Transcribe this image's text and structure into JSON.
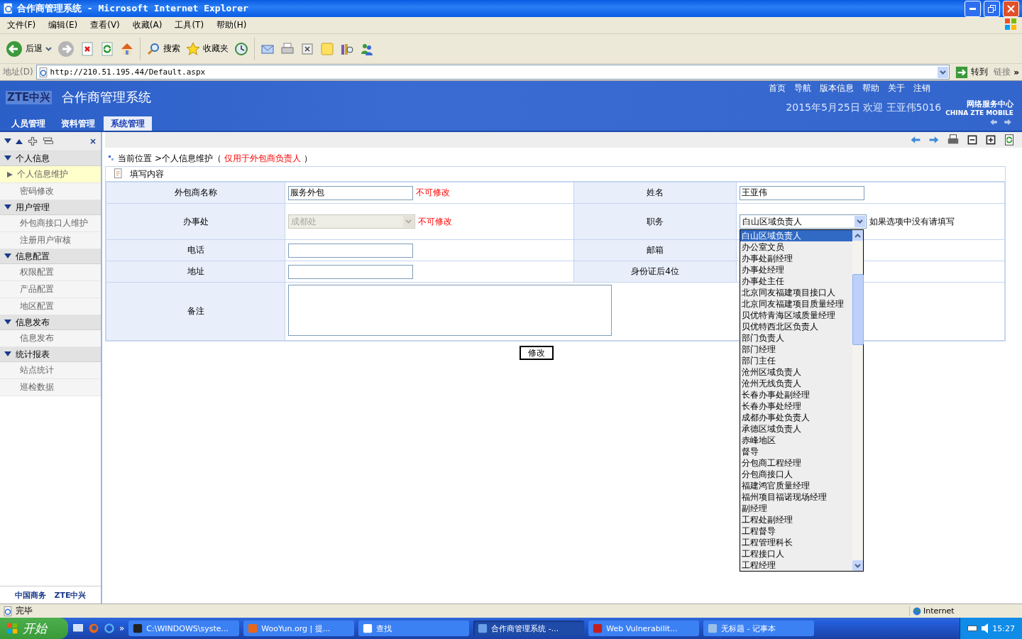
{
  "window": {
    "title": "合作商管理系统 - Microsoft Internet Explorer"
  },
  "menu": [
    "文件(F)",
    "编辑(E)",
    "查看(V)",
    "收藏(A)",
    "工具(T)",
    "帮助(H)"
  ],
  "toolbar": {
    "back": "后退",
    "search": "搜索",
    "favorites": "收藏夹"
  },
  "address": {
    "label": "地址(D)",
    "url": "http://210.51.195.44/Default.aspx",
    "go": "转到",
    "links": "链接",
    "more": "»"
  },
  "header": {
    "logo": "ZTE中兴",
    "title": "合作商管理系统",
    "nav": [
      "首页",
      "导航",
      "版本信息",
      "帮助",
      "关于",
      "注销"
    ],
    "welcome": "2015年5月25日 欢迎 王亚伟5016",
    "brand": "网络服务中心",
    "brand_sub": "CHINA ZTE MOBILE",
    "tabs": [
      {
        "label": "人员管理",
        "selected": false
      },
      {
        "label": "资料管理",
        "selected": false
      },
      {
        "label": "系统管理",
        "selected": true
      }
    ]
  },
  "sidebar": {
    "close": "×",
    "groups": [
      {
        "title": "个人信息",
        "expanded": true,
        "items": [
          {
            "label": "个人信息维护",
            "selected": true
          },
          {
            "label": "密码修改",
            "selected": false
          }
        ]
      },
      {
        "title": "用户管理",
        "expanded": true,
        "items": [
          {
            "label": "外包商接口人维护",
            "selected": false
          },
          {
            "label": "注册用户审核",
            "selected": false
          }
        ]
      },
      {
        "title": "信息配置",
        "expanded": true,
        "items": [
          {
            "label": "权限配置",
            "selected": false
          },
          {
            "label": "产品配置",
            "selected": false
          },
          {
            "label": "地区配置",
            "selected": false
          }
        ]
      },
      {
        "title": "信息发布",
        "expanded": true,
        "items": [
          {
            "label": "信息发布",
            "selected": false
          }
        ]
      },
      {
        "title": "统计报表",
        "expanded": true,
        "items": [
          {
            "label": "站点统计",
            "selected": false
          },
          {
            "label": "巡检数据",
            "selected": false
          }
        ]
      }
    ],
    "footer": [
      "中国商务",
      "ZTE中兴"
    ]
  },
  "breadcrumb": {
    "label": "当前位置",
    "path": ">个人信息维护（",
    "note": "仅用于外包商负责人",
    "tail": "）"
  },
  "section": "填写内容",
  "form": {
    "rows": [
      {
        "cells": [
          {
            "label": "外包商名称",
            "kind": "text",
            "value": "服务外包",
            "note": "不可修改"
          },
          {
            "label": "姓名",
            "kind": "text",
            "value": "王亚伟"
          }
        ]
      },
      {
        "cells": [
          {
            "label": "办事处",
            "kind": "select",
            "value": "成都处",
            "disabled": true,
            "note": "不可修改"
          },
          {
            "label": "职务",
            "kind": "select",
            "value": "白山区域负责人",
            "disabled": false,
            "hint": "如果选项中没有请填写"
          }
        ]
      },
      {
        "cells": [
          {
            "label": "电话",
            "kind": "text"
          },
          {
            "label": "邮箱",
            "kind": "covered"
          }
        ]
      },
      {
        "cells": [
          {
            "label": "地址",
            "kind": "text"
          },
          {
            "label": "身份证后4位",
            "kind": "covered"
          }
        ]
      }
    ],
    "remark": {
      "label": "备注"
    },
    "submit": "修改"
  },
  "dropdown": {
    "options": [
      {
        "label": "白山区域负责人",
        "selected": true
      },
      {
        "label": "办公室文员",
        "selected": false
      },
      {
        "label": "办事处副经理",
        "selected": false
      },
      {
        "label": "办事处经理",
        "selected": false
      },
      {
        "label": "办事处主任",
        "selected": false
      },
      {
        "label": "北京同友福建项目接口人",
        "selected": false
      },
      {
        "label": "北京同友福建项目质量经理",
        "selected": false
      },
      {
        "label": "贝优特青海区域质量经理",
        "selected": false
      },
      {
        "label": "贝优特西北区负责人",
        "selected": false
      },
      {
        "label": "部门负责人",
        "selected": false
      },
      {
        "label": "部门经理",
        "selected": false
      },
      {
        "label": "部门主任",
        "selected": false
      },
      {
        "label": "沧州区域负责人",
        "selected": false
      },
      {
        "label": "沧州无线负责人",
        "selected": false
      },
      {
        "label": "长春办事处副经理",
        "selected": false
      },
      {
        "label": "长春办事处经理",
        "selected": false
      },
      {
        "label": "成都办事处负责人",
        "selected": false
      },
      {
        "label": "承德区域负责人",
        "selected": false
      },
      {
        "label": "赤峰地区",
        "selected": false
      },
      {
        "label": "督导",
        "selected": false
      },
      {
        "label": "分包商工程经理",
        "selected": false
      },
      {
        "label": "分包商接口人",
        "selected": false
      },
      {
        "label": "福建鸿官质量经理",
        "selected": false
      },
      {
        "label": "福州项目福诺现场经理",
        "selected": false
      },
      {
        "label": "副经理",
        "selected": false
      },
      {
        "label": "工程处副经理",
        "selected": false
      },
      {
        "label": "工程督导",
        "selected": false
      },
      {
        "label": "工程管理科长",
        "selected": false
      },
      {
        "label": "工程接口人",
        "selected": false
      },
      {
        "label": "工程经理",
        "selected": false
      }
    ]
  },
  "status": {
    "text": "完毕",
    "zone": "Internet"
  },
  "taskbar": {
    "start": "开始",
    "more": "»",
    "tasks": [
      {
        "label": "C:\\WINDOWS\\syste...",
        "selected": false
      },
      {
        "label": "WooYun.org | 提...",
        "selected": false
      },
      {
        "label": "查找",
        "selected": false
      },
      {
        "label": "合作商管理系统 -...",
        "selected": true
      },
      {
        "label": "Web Vulnerabilit...",
        "selected": false
      },
      {
        "label": "无标题 - 记事本",
        "selected": false
      }
    ],
    "clock": "15:27"
  }
}
